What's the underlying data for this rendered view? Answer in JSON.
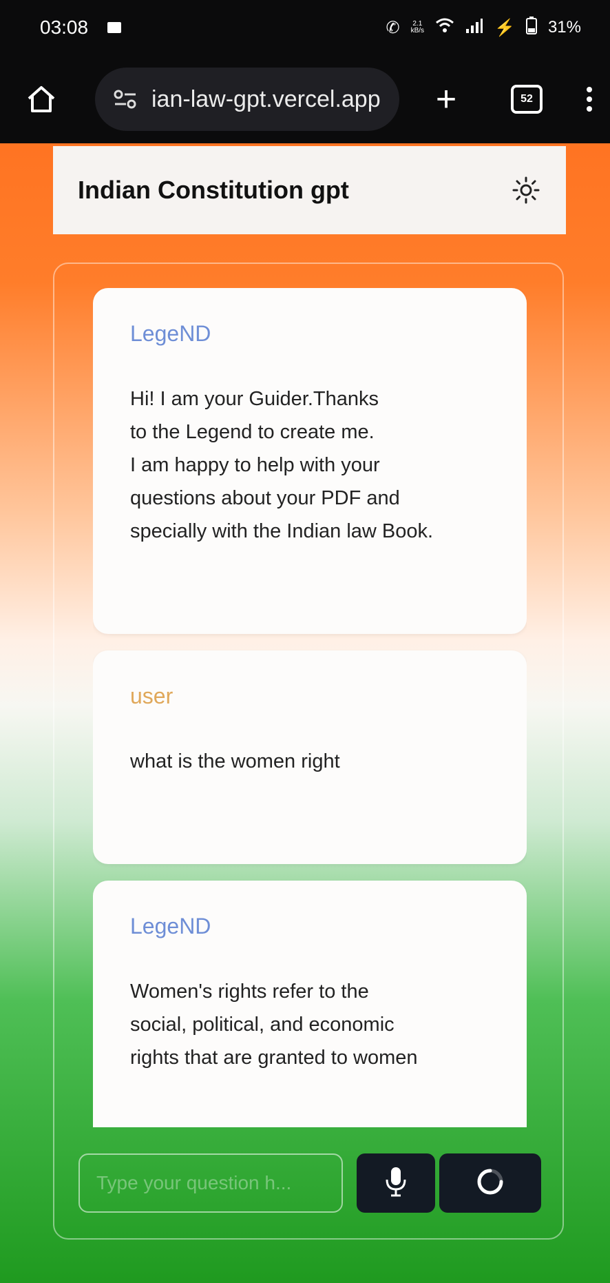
{
  "status": {
    "time": "03:08",
    "network_speed": "2.1\nkB/s",
    "battery": "31%"
  },
  "browser": {
    "url": "ian-law-gpt.vercel.app",
    "tab_count": "52"
  },
  "app": {
    "title": "Indian Constitution gpt"
  },
  "messages": [
    {
      "sender": "LegeND",
      "role": "bot",
      "text": "Hi! I am your Guider.Thanks\nto the Legend to create me.\nI am happy to help with your\nquestions about your PDF and\nspecially with the Indian law Book."
    },
    {
      "sender": "user",
      "role": "user",
      "text": "what is the women right"
    },
    {
      "sender": "LegeND",
      "role": "bot",
      "text": "Women's rights refer to the\nsocial, political, and economic\nrights that are granted to women"
    }
  ],
  "input": {
    "placeholder": "Type your question h..."
  },
  "colors": {
    "saffron": "#ff6a1a",
    "green": "#1f9a1f",
    "bot_name": "#6e8ed6",
    "user_name": "#e0a85a"
  }
}
